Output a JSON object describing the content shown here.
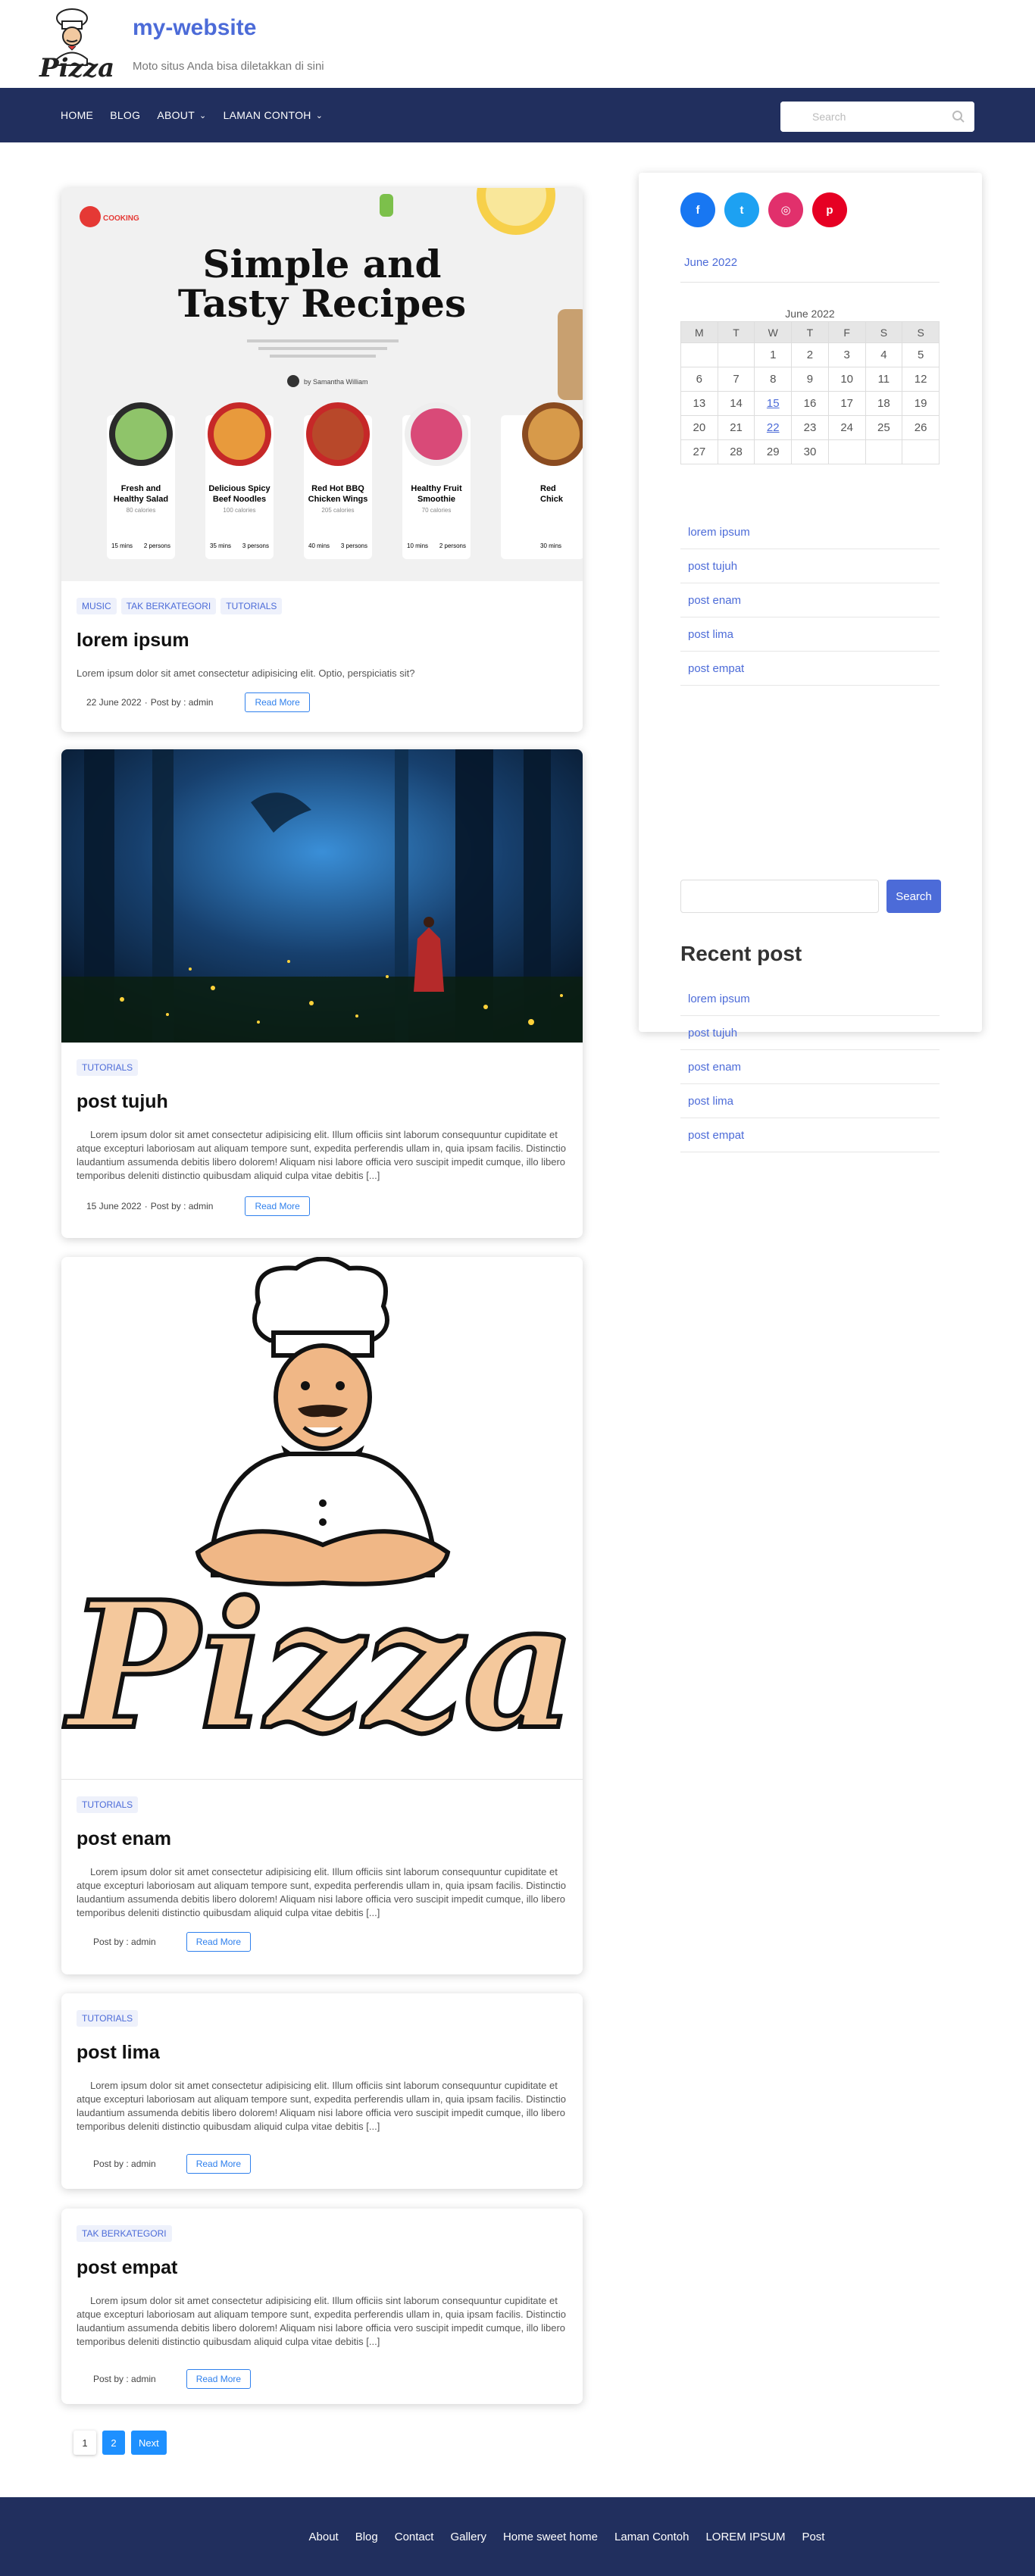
{
  "site": {
    "title": "my-website",
    "description": "Moto situs Anda bisa diletakkan di sini",
    "logo_text": "Pizza"
  },
  "nav": {
    "items": [
      {
        "label": "HOME",
        "dropdown": false
      },
      {
        "label": "BLOG",
        "dropdown": false
      },
      {
        "label": "ABOUT",
        "dropdown": true
      },
      {
        "label": "LAMAN CONTOH",
        "dropdown": true
      }
    ],
    "search_placeholder": "Search"
  },
  "posts": [
    {
      "categories": [
        "MUSIC",
        "TAK BERKATEGORI",
        "TUTORIALS"
      ],
      "title": "lorem ipsum",
      "excerpt": "Lorem ipsum dolor sit amet consectetur adipisicing elit. Optio, perspiciatis sit?",
      "date": "22 June 2022",
      "author": "Post by : admin",
      "read_more": "Read More",
      "thumbnail": {
        "badge": "COOKING",
        "headline_1": "Simple and",
        "headline_2": "Tasty Recipes",
        "byline": "by Samantha William",
        "dishes": [
          {
            "name_1": "Fresh and",
            "name_2": "Healthy Salad",
            "cal": "80 calories",
            "time": "15 mins",
            "serve": "2 persons"
          },
          {
            "name_1": "Delicious Spicy",
            "name_2": "Beef Noodles",
            "cal": "100 calories",
            "time": "35 mins",
            "serve": "3 persons"
          },
          {
            "name_1": "Red Hot BBQ",
            "name_2": "Chicken Wings",
            "cal": "205 calories",
            "time": "40 mins",
            "serve": "3 persons"
          },
          {
            "name_1": "Healthy Fruit",
            "name_2": "Smoothie",
            "cal": "70 calories",
            "time": "10 mins",
            "serve": "2 persons"
          },
          {
            "name_1": "Red",
            "name_2": "Chick",
            "cal": "",
            "time": "30 mins",
            "serve": ""
          }
        ]
      }
    },
    {
      "categories": [
        "TUTORIALS"
      ],
      "title": "post tujuh",
      "excerpt": "Lorem ipsum dolor sit amet consectetur adipisicing elit. Illum officiis sint laborum consequuntur cupiditate et atque excepturi laboriosam aut aliquam tempore sunt, expedita perferendis ullam in, quia ipsam facilis. Distinctio laudantium assumenda debitis libero dolorem! Aliquam nisi labore officia vero suscipit impedit cumque, illo libero temporibus deleniti distinctio quibusdam aliquid culpa vitae debitis [...]",
      "date": "15 June 2022",
      "author": "Post by : admin",
      "read_more": "Read More"
    },
    {
      "categories": [
        "TUTORIALS"
      ],
      "title": "post enam",
      "excerpt": "Lorem ipsum dolor sit amet consectetur adipisicing elit. Illum officiis sint laborum consequuntur cupiditate et atque excepturi laboriosam aut aliquam tempore sunt, expedita perferendis ullam in, quia ipsam facilis. Distinctio laudantium assumenda debitis libero dolorem! Aliquam nisi labore officia vero suscipit impedit cumque, illo libero temporibus deleniti distinctio quibusdam aliquid culpa vitae debitis [...]",
      "author": "Post by : admin",
      "read_more": "Read More",
      "thumbnail_text": "Pizza"
    },
    {
      "categories": [
        "TUTORIALS"
      ],
      "title": "post lima",
      "excerpt": "Lorem ipsum dolor sit amet consectetur adipisicing elit. Illum officiis sint laborum consequuntur cupiditate et atque excepturi laboriosam aut aliquam tempore sunt, expedita perferendis ullam in, quia ipsam facilis. Distinctio laudantium assumenda debitis libero dolorem! Aliquam nisi labore officia vero suscipit impedit cumque, illo libero temporibus deleniti distinctio quibusdam aliquid culpa vitae debitis [...]",
      "author": "Post by : admin",
      "read_more": "Read More"
    },
    {
      "categories": [
        "TAK BERKATEGORI"
      ],
      "title": "post empat",
      "excerpt": "Lorem ipsum dolor sit amet consectetur adipisicing elit. Illum officiis sint laborum consequuntur cupiditate et atque excepturi laboriosam aut aliquam tempore sunt, expedita perferendis ullam in, quia ipsam facilis. Distinctio laudantium assumenda debitis libero dolorem! Aliquam nisi labore officia vero suscipit impedit cumque, illo libero temporibus deleniti distinctio quibusdam aliquid culpa vitae debitis [...]",
      "author": "Post by : admin",
      "read_more": "Read More"
    }
  ],
  "pagination": {
    "current": "1",
    "page2": "2",
    "next": "Next"
  },
  "sidebar": {
    "socials": [
      {
        "icon": "facebook-icon",
        "glyph": "f",
        "color": "#1877f2"
      },
      {
        "icon": "twitter-icon",
        "glyph": "t",
        "color": "#1da1f2"
      },
      {
        "icon": "instagram-icon",
        "glyph": "◎",
        "color": "#e1306c"
      },
      {
        "icon": "pinterest-icon",
        "glyph": "p",
        "color": "#e60023"
      }
    ],
    "archive": "June 2022",
    "calendar": {
      "caption": "June 2022",
      "days": [
        "M",
        "T",
        "W",
        "T",
        "F",
        "S",
        "S"
      ],
      "weeks": [
        [
          "",
          "",
          "1",
          "2",
          "3",
          "4",
          "5"
        ],
        [
          "6",
          "7",
          "8",
          "9",
          "10",
          "11",
          "12"
        ],
        [
          "13",
          "14",
          "15",
          "16",
          "17",
          "18",
          "19"
        ],
        [
          "20",
          "21",
          "22",
          "23",
          "24",
          "25",
          "26"
        ],
        [
          "27",
          "28",
          "29",
          "30",
          "",
          "",
          ""
        ]
      ],
      "linked_days": [
        "15",
        "22"
      ]
    },
    "pages": [
      "lorem ipsum",
      "post tujuh",
      "post enam",
      "post lima",
      "post empat"
    ],
    "search_button": "Search",
    "recent_heading": "Recent post",
    "recent": [
      "lorem ipsum",
      "post tujuh",
      "post enam",
      "post lima",
      "post empat"
    ]
  },
  "footer": {
    "links": [
      "About",
      "Blog",
      "Contact",
      "Gallery",
      "Home sweet home",
      "Laman Contoh",
      "LOREM IPSUM",
      "Post"
    ]
  },
  "colors": {
    "nav_bg": "#212f5e",
    "accent": "#4c6bd8",
    "button_blue": "#1e90ff"
  }
}
